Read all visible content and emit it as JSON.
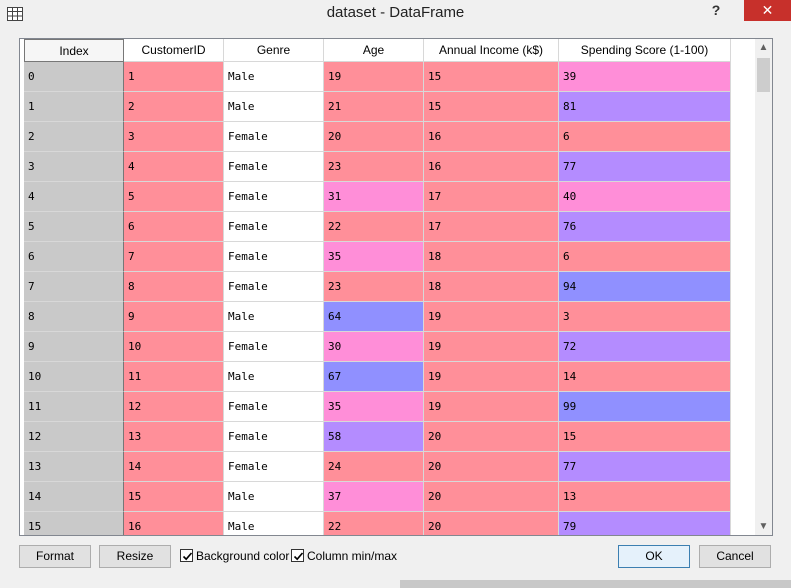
{
  "window": {
    "title": "dataset - DataFrame",
    "help_label": "?",
    "close_label": "✕"
  },
  "icons": {
    "app": "grid-icon",
    "help": "help-icon",
    "close": "close-icon",
    "check": "check-icon"
  },
  "colors": {
    "high": "#9090ff",
    "mid_high": "#b48cff",
    "mid": "#ff8ed8",
    "low": "#ff8f99",
    "index_col": "#c9c9c9",
    "close": "#c7302b"
  },
  "table": {
    "columns": [
      "Index",
      "CustomerID",
      "Genre",
      "Age",
      "Annual Income (k$)",
      "Spending Score (1-100)"
    ],
    "rows": [
      [
        "0",
        "1",
        "Male",
        "19",
        "15",
        "39"
      ],
      [
        "1",
        "2",
        "Male",
        "21",
        "15",
        "81"
      ],
      [
        "2",
        "3",
        "Female",
        "20",
        "16",
        "6"
      ],
      [
        "3",
        "4",
        "Female",
        "23",
        "16",
        "77"
      ],
      [
        "4",
        "5",
        "Female",
        "31",
        "17",
        "40"
      ],
      [
        "5",
        "6",
        "Female",
        "22",
        "17",
        "76"
      ],
      [
        "6",
        "7",
        "Female",
        "35",
        "18",
        "6"
      ],
      [
        "7",
        "8",
        "Female",
        "23",
        "18",
        "94"
      ],
      [
        "8",
        "9",
        "Male",
        "64",
        "19",
        "3"
      ],
      [
        "9",
        "10",
        "Female",
        "30",
        "19",
        "72"
      ],
      [
        "10",
        "11",
        "Male",
        "67",
        "19",
        "14"
      ],
      [
        "11",
        "12",
        "Female",
        "35",
        "19",
        "99"
      ],
      [
        "12",
        "13",
        "Female",
        "58",
        "20",
        "15"
      ],
      [
        "13",
        "14",
        "Female",
        "24",
        "20",
        "77"
      ],
      [
        "14",
        "15",
        "Male",
        "37",
        "20",
        "13"
      ],
      [
        "15",
        "16",
        "Male",
        "22",
        "20",
        "79"
      ]
    ],
    "cell_colors": [
      [
        "#ff8f99",
        "#ff8f99",
        "#ff8f99",
        "#ff8ed8"
      ],
      [
        "#ff8f99",
        "#ff8f99",
        "#ff8f99",
        "#b48cff"
      ],
      [
        "#ff8f99",
        "#ff8f99",
        "#ff8f99",
        "#ff8f99"
      ],
      [
        "#ff8f99",
        "#ff8f99",
        "#ff8f99",
        "#b48cff"
      ],
      [
        "#ff8f99",
        "#ff8ed8",
        "#ff8f99",
        "#ff8ed8"
      ],
      [
        "#ff8f99",
        "#ff8f99",
        "#ff8f99",
        "#b48cff"
      ],
      [
        "#ff8f99",
        "#ff8ed8",
        "#ff8f99",
        "#ff8f99"
      ],
      [
        "#ff8f99",
        "#ff8f99",
        "#ff8f99",
        "#9090ff"
      ],
      [
        "#ff8f99",
        "#9090ff",
        "#ff8f99",
        "#ff8f99"
      ],
      [
        "#ff8f99",
        "#ff8ed8",
        "#ff8f99",
        "#b48cff"
      ],
      [
        "#ff8f99",
        "#9090ff",
        "#ff8f99",
        "#ff8f99"
      ],
      [
        "#ff8f99",
        "#ff8ed8",
        "#ff8f99",
        "#9090ff"
      ],
      [
        "#ff8f99",
        "#b48cff",
        "#ff8f99",
        "#ff8f99"
      ],
      [
        "#ff8f99",
        "#ff8f99",
        "#ff8f99",
        "#b48cff"
      ],
      [
        "#ff8f99",
        "#ff8ed8",
        "#ff8f99",
        "#ff8f99"
      ],
      [
        "#ff8f99",
        "#ff8f99",
        "#ff8f99",
        "#b48cff"
      ]
    ]
  },
  "buttons": {
    "format": "Format",
    "resize": "Resize",
    "ok": "OK",
    "cancel": "Cancel"
  },
  "checkboxes": {
    "background_color": {
      "label": "Background color",
      "checked": true
    },
    "column_minmax": {
      "label": "Column min/max",
      "checked": true
    }
  }
}
